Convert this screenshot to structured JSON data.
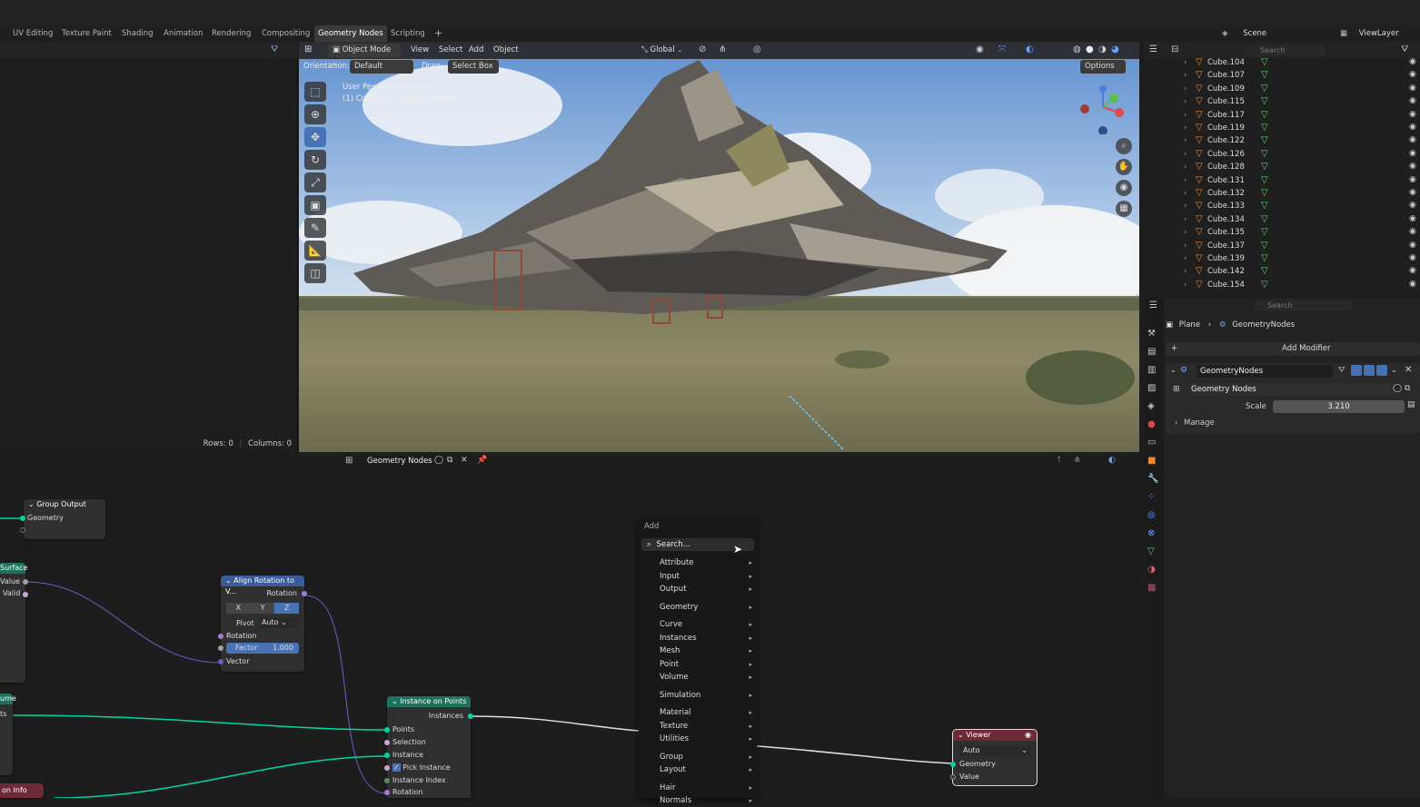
{
  "workspace_tabs": [
    "UV Editing",
    "Texture Paint",
    "Shading",
    "Animation",
    "Rendering",
    "Compositing",
    "Geometry Nodes",
    "Scripting",
    "+"
  ],
  "active_tab": "Geometry Nodes",
  "scene": {
    "scene_label": "Scene",
    "viewlayer_label": "ViewLayer"
  },
  "spreadsheet": {
    "rows": "Rows: 0",
    "columns": "Columns: 0"
  },
  "viewport": {
    "mode": "Object Mode",
    "menus": [
      "View",
      "Select",
      "Add",
      "Object"
    ],
    "transform": "Global",
    "orientation_label": "Orientation:",
    "orientation_value": "Default",
    "drag_label": "Drag:",
    "drag_value": "Select Box",
    "options_label": "Options",
    "overlay_line1": "User Perspective (Local)",
    "overlay_line2": "(1) Collection | Plane (Viewer)"
  },
  "outliner": {
    "search_placeholder": "Search",
    "items": [
      "Cube.104",
      "Cube.107",
      "Cube.109",
      "Cube.115",
      "Cube.117",
      "Cube.119",
      "Cube.122",
      "Cube.126",
      "Cube.128",
      "Cube.131",
      "Cube.132",
      "Cube.133",
      "Cube.134",
      "Cube.135",
      "Cube.137",
      "Cube.139",
      "Cube.142",
      "Cube.154"
    ]
  },
  "properties": {
    "search_placeholder": "Search",
    "breadcrumb_object": "Plane",
    "breadcrumb_modifier": "GeometryNodes",
    "add_modifier": "Add Modifier",
    "modifier_name": "GeometryNodes",
    "node_group": "Geometry Nodes",
    "scale_label": "Scale",
    "scale_value": "3.210",
    "manage_label": "Manage"
  },
  "node_editor": {
    "title": "Geometry Nodes",
    "nodes": {
      "group_output": {
        "title": "Group Output",
        "socket": "Geometry"
      },
      "surface": {
        "title": "Surface",
        "value": "Value",
        "valid": "Valid"
      },
      "align": {
        "title": "Align Rotation to V...",
        "rotation_out": "Rotation",
        "x": "X",
        "y": "Y",
        "z": "Z",
        "pivot_label": "Pivot",
        "pivot_value": "Auto",
        "rotation_in": "Rotation",
        "factor_label": "Factor",
        "factor_value": "1.000",
        "vector": "Vector"
      },
      "instance": {
        "title": "Instance on Points",
        "instances": "Instances",
        "points": "Points",
        "selection": "Selection",
        "instance": "Instance",
        "pick_instance": "Pick Instance",
        "instance_index": "Instance Index",
        "rotation": "Rotation"
      },
      "viewer": {
        "title": "Viewer",
        "domain": "Auto",
        "geometry": "Geometry",
        "value": "Value"
      },
      "frag_ume": "ume",
      "frag_ts": "ts",
      "frag_info": "on Info"
    }
  },
  "add_menu": {
    "title": "Add",
    "search": "Search...",
    "groups": [
      [
        "Attribute",
        "Input",
        "Output"
      ],
      [
        "Geometry"
      ],
      [
        "Curve",
        "Instances",
        "Mesh",
        "Point",
        "Volume"
      ],
      [
        "Simulation"
      ],
      [
        "Material",
        "Texture",
        "Utilities"
      ],
      [
        "Group",
        "Layout"
      ],
      [
        "Hair",
        "Normals"
      ]
    ]
  },
  "colors": {
    "accent": "#4772b3",
    "geometry_socket": "#00d6a3",
    "vector_socket": "#6363c7",
    "node_green_header": "#1d725e",
    "node_blue_header": "#3b5c9b",
    "viewer_header": "#6e2a37",
    "cube_icon": "#e58a3a",
    "mesh_icon": "#5fd16a"
  }
}
